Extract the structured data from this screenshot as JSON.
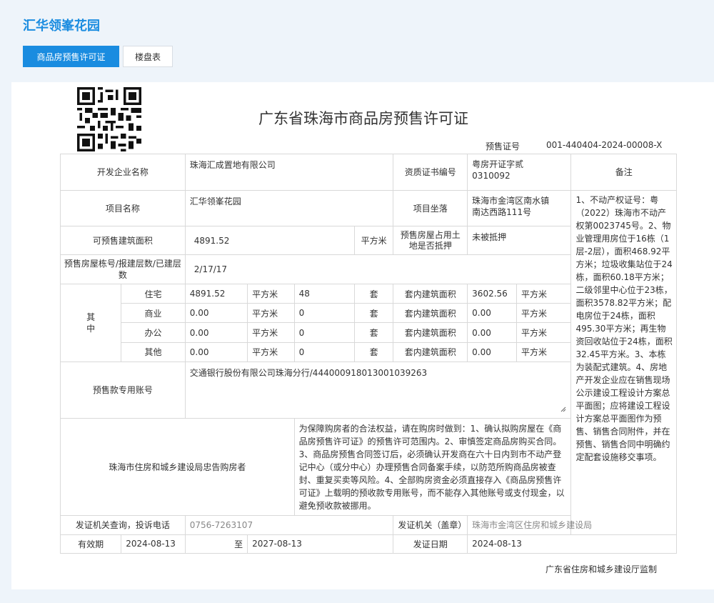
{
  "project_title": "汇华领峯花园",
  "tabs": [
    {
      "label": "商品房预售许可证",
      "active": true
    },
    {
      "label": "楼盘表",
      "active": false
    }
  ],
  "doc": {
    "title": "广东省珠海市商品房预售许可证",
    "license_label": "预售证号",
    "license_no": "001-440404-2024-00008-X"
  },
  "table": {
    "developer_label": "开发企业名称",
    "developer": "珠海汇成置地有限公司",
    "qual_label": "资质证书编号",
    "qual_no": "粤房开证字贰\n0310092",
    "remark_label": "备注",
    "project_label": "项目名称",
    "project": "汇华领峯花园",
    "location_label": "项目坐落",
    "location": "珠海市金湾区南水镇\n南达西路111号",
    "area_label": "可预售建筑面积",
    "area": "4891.52",
    "area_unit": "平方米",
    "mortgage_label": "预售房屋占用土地是否抵押",
    "mortgage": "未被抵押",
    "building_label": "预售房屋栋号/报建层数/已建层数",
    "building": "2/17/17",
    "among_label": "其\n中",
    "unit_sqm": "平方米",
    "unit_set": "套",
    "inner_label": "套内建筑面积",
    "rows": [
      {
        "type": "住宅",
        "area": "4891.52",
        "count": "48",
        "inner": "3602.56"
      },
      {
        "type": "商业",
        "area": "0.00",
        "count": "0",
        "inner": "0.00"
      },
      {
        "type": "办公",
        "area": "0.00",
        "count": "0",
        "inner": "0.00"
      },
      {
        "type": "其他",
        "area": "0.00",
        "count": "0",
        "inner": "0.00"
      }
    ],
    "account_label": "预售款专用账号",
    "account": "交通银行股份有限公司珠海分行/444000918013001039263",
    "warning_label": "珠海市住房和城乡建设局忠告购房者",
    "warning_text": "为保障购房者的合法权益，请在购房时做到：1、确认拟购房屋在《商品房预售许可证》的预售许可范围内。2、审慎签定商品房购买合同。3、商品房预售合同签订后，必须确认开发商在六十日内到市不动产登记中心（或分中心）办理预售合同备案手续，以防范所购商品房被查封、重复买卖等风险。4、全部购房资金必须直接存入《商品房预售许可证》上载明的预收款专用账号，而不能存入其他账号或支付现金，以避免预收款被挪用。",
    "remarks": "1、不动产权证号：粤（2022）珠海市不动产权第0023745号。2、物业管理用房位于16栋（1层-2层），面积468.92平方米；垃圾收集站位于24栋，面积60.18平方米；二级邻里中心位于23栋，面积3578.82平方米；配电房位于24栋，面积495.30平方米；再生物资回收站位于24栋，面积32.45平方米。3、本栋为装配式建筑。4、房地产开发企业应在销售现场公示建设工程设计方案总平面图；应将建设工程设计方案总平面图作为预售、销售合同附件，并在预售、销售合同中明确约定配套设施移交事项。",
    "hotline_label": "发证机关查询，投诉电话",
    "hotline": "0756-7263107",
    "issuer_label": "发证机关（盖章）",
    "issuer": "珠海市金湾区住房和城乡建设局",
    "validity_label": "有效期",
    "valid_from": "2024-08-13",
    "to_label": "至",
    "valid_to": "2027-08-13",
    "issue_date_label": "发证日期",
    "issue_date": "2024-08-13"
  },
  "footer_note": "广东省住房和城乡建设厅监制"
}
